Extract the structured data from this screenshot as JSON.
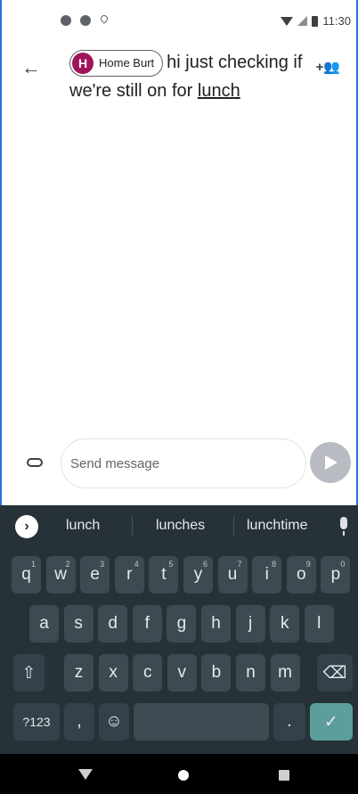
{
  "status_bar": {
    "time": "11:30",
    "icons": [
      "app-icon",
      "app-icon",
      "location-icon",
      "wifi-icon",
      "signal-icon",
      "battery-icon"
    ]
  },
  "compose": {
    "recipient_chip": {
      "initial": "H",
      "name": "Home Burt",
      "avatar_color": "#a0145a"
    },
    "message_text_before": "hi just checking if we're still on for ",
    "message_text_underlined": "lunch"
  },
  "message_bar": {
    "placeholder": "Send message"
  },
  "keyboard": {
    "suggestions": [
      "lunch",
      "lunches",
      "lunchtime"
    ],
    "row1": [
      {
        "k": "q",
        "h": "1"
      },
      {
        "k": "w",
        "h": "2"
      },
      {
        "k": "e",
        "h": "3"
      },
      {
        "k": "r",
        "h": "4"
      },
      {
        "k": "t",
        "h": "5"
      },
      {
        "k": "y",
        "h": "6"
      },
      {
        "k": "u",
        "h": "7"
      },
      {
        "k": "i",
        "h": "8"
      },
      {
        "k": "o",
        "h": "9"
      },
      {
        "k": "p",
        "h": "0"
      }
    ],
    "row2": [
      "a",
      "s",
      "d",
      "f",
      "g",
      "h",
      "j",
      "k",
      "l"
    ],
    "row3": [
      "z",
      "x",
      "c",
      "v",
      "b",
      "n",
      "m"
    ],
    "row4": {
      "symbols": "?123",
      "comma": ",",
      "period": "."
    },
    "colors": {
      "background": "#263238",
      "key": "#3c4a51",
      "enter": "#5c9e9b"
    }
  }
}
